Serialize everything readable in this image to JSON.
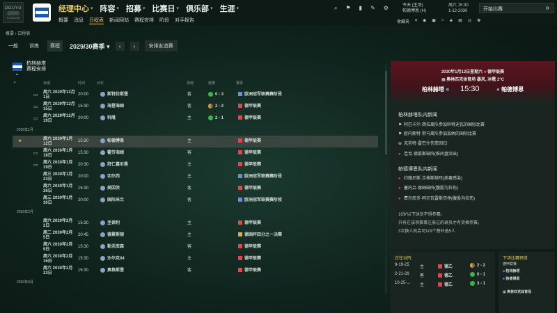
{
  "topbar": {
    "logo_text": "DOUYU",
    "logo_sub": "5,003,135",
    "main_nav": [
      {
        "label": "经理中心",
        "active": true
      },
      {
        "label": "阵容"
      },
      {
        "label": "招募"
      },
      {
        "label": "比赛日"
      },
      {
        "label": "俱乐部"
      },
      {
        "label": "生涯"
      }
    ],
    "sub_nav": [
      "概要",
      "消息",
      "日程表",
      "新闻网站",
      "赛程安排",
      "阶段",
      "对手报告"
    ],
    "sub_nav_active": "日程表",
    "date_line1": "今天 (主场)",
    "date_line2": "帕德博恩 (H)",
    "date_line3": "周六 15:30",
    "date_line4": "1-12-2030",
    "continue_label": "开始比赛",
    "continue_icon": "double-chevron-right-icon",
    "right_tools_label": "收藏夹"
  },
  "breadcrumb": "概要 › 日程表",
  "tabs": [
    "一般",
    "训练",
    "赛程"
  ],
  "tabs_active": "赛程",
  "season_label": "2029/30赛季",
  "friendly_button": "安排友谊赛",
  "team": {
    "name_line1": "柏林赫塔",
    "name_line2": "赛程安排"
  },
  "columns": {
    "date": "日期",
    "time": "时间",
    "opponent": "对手",
    "venue": "场地",
    "result": "结果",
    "competition": "赛事"
  },
  "months": [
    "2030年1月",
    "2030年2月",
    "2030年3月"
  ],
  "fixtures": [
    {
      "date1": "周六 2029年12月",
      "date2": "1日",
      "time": "20:00",
      "opponent": "斯特拉斯堡",
      "venue": "客",
      "result": "0 - 3",
      "res": "win",
      "comp": "欧洲冠军联赛赛阶段",
      "tv": true
    },
    {
      "date1": "周六 2029年12月",
      "date2": "15日",
      "time": "15:30",
      "opponent": "海登海姆",
      "venue": "客",
      "result": "2 - 2",
      "res": "draw",
      "comp": "德甲联赛",
      "tv": true
    },
    {
      "date1": "周六 2029年12月",
      "date2": "19日",
      "time": "20:00",
      "opponent": "科隆",
      "venue": "主",
      "result": "2 - 1",
      "res": "win",
      "comp": "德甲联赛",
      "tv": true
    },
    {
      "date1": "周六 2030年1月",
      "date2": "12日",
      "time": "15:30",
      "opponent": "帕德博恩",
      "venue": "主",
      "result": "",
      "res": "",
      "comp": "德甲联赛",
      "tv": false,
      "highlight": true
    },
    {
      "date1": "周六 2030年1月",
      "date2": "18日",
      "time": "15:30",
      "opponent": "霍芬海姆",
      "venue": "客",
      "result": "",
      "res": "",
      "comp": "德甲联赛",
      "tv": true
    },
    {
      "date1": "周六 2030年1月",
      "date2": "19日",
      "time": "20:30",
      "opponent": "拜仁慕尼黑",
      "venue": "主",
      "result": "",
      "res": "",
      "comp": "德甲联赛",
      "tv": true
    },
    {
      "date1": "周三 2030年1月",
      "date2": "23日",
      "time": "20:00",
      "opponent": "切尔西",
      "venue": "主",
      "result": "",
      "res": "",
      "comp": "欧洲冠军联赛赛阶段",
      "tv": false
    },
    {
      "date1": "周六 2030年1月",
      "date2": "26日",
      "time": "15:30",
      "opponent": "美因茨",
      "venue": "客",
      "result": "",
      "res": "",
      "comp": "德甲联赛",
      "tv": false
    },
    {
      "date1": "周三 2030年1月",
      "date2": "30日",
      "time": "20:00",
      "opponent": "国际米兰",
      "venue": "客",
      "result": "",
      "res": "",
      "comp": "欧洲冠军联赛赛阶段",
      "tv": false
    },
    {
      "date1": "周六 2030年2月",
      "date2": "2日",
      "time": "15:30",
      "opponent": "圣保利",
      "venue": "主",
      "result": "",
      "res": "",
      "comp": "德甲联赛",
      "tv": false
    },
    {
      "date1": "周二 2030年2月",
      "date2": "5日",
      "time": "20:45",
      "opponent": "德累斯顿",
      "venue": "主",
      "result": "",
      "res": "",
      "comp": "德国杯四分之一决赛",
      "tv": false
    },
    {
      "date1": "周六 2030年2月",
      "date2": "9日",
      "time": "15:30",
      "opponent": "勒沃库森",
      "venue": "客",
      "result": "",
      "res": "",
      "comp": "德甲联赛",
      "tv": false
    },
    {
      "date1": "周六 2030年2月",
      "date2": "16日",
      "time": "15:30",
      "opponent": "沙尔克04",
      "venue": "主",
      "result": "",
      "res": "",
      "comp": "德甲联赛",
      "tv": false
    },
    {
      "date1": "周六 2030年2月",
      "date2": "23日",
      "time": "15:30",
      "opponent": "奥格斯堡",
      "venue": "客",
      "result": "",
      "res": "",
      "comp": "德甲联赛",
      "tv": false
    }
  ],
  "match_card": {
    "date": "2030年1月12日星期六",
    "competition": "德甲联赛",
    "venue": "奥林匹克体育场",
    "weather": "暴风, 冰雹 2°C",
    "home": "柏林赫塔",
    "time": "15:30",
    "away": "帕德博恩",
    "home_news_title": "柏林赫塔队内新闻",
    "home_news": [
      {
        "icon": "flag-icon",
        "text": "阿巴卡尔·西拉离队参加科特迪瓦的国际比赛"
      },
      {
        "icon": "flag-icon",
        "text": "欧内斯特·努马离队参加加纳的国际比赛"
      },
      {
        "icon": "plus-icon",
        "text": "克劳特·雷巴什伤愈回归"
      },
      {
        "icon": "red-icon",
        "text": "连戈·德慕斯缺阵(椎间盘突出)"
      }
    ],
    "away_news_title": "帕德博恩队内新闻",
    "away_news": [
      {
        "icon": "red-icon",
        "text": "约翰尼斯·艾格斯缺阵(病毒感染)"
      },
      {
        "icon": "red-icon",
        "text": "塞内吕·德姆缺阵(腹股沟拉伤)"
      },
      {
        "icon": "red-icon",
        "text": "费尔南多·阿尔瓦雷斯伤停(腹股沟拉伤)"
      }
    ],
    "notes": [
      "16岁以下球员不得参赛。",
      "只有在该项赛事注册过的球员才有资格参赛。",
      "3次换人机会可以9个替补选5人"
    ]
  },
  "past_meetings": {
    "title": "过往对阵",
    "rows": [
      {
        "date": "9-19-25",
        "venue": "主",
        "comp": "德乙",
        "score": "2 - 2",
        "res": "draw"
      },
      {
        "date": "2-21-26",
        "venue": "客",
        "comp": "德乙",
        "score": "0 - 1",
        "res": "win"
      },
      {
        "date": "10-25-...",
        "venue": "主",
        "comp": "德乙",
        "score": "3 - 1",
        "res": "win"
      }
    ]
  },
  "next_preview": {
    "title": "下场比赛预览",
    "sub": "德甲联赛",
    "home": "柏林赫塔",
    "away": "帕德博恩",
    "venue": "奥林匹克体育场"
  }
}
